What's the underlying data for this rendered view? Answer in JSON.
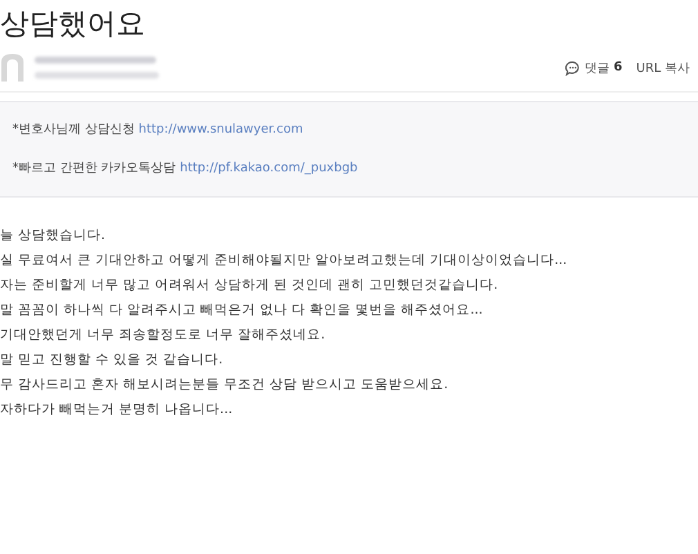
{
  "post": {
    "title": "상담했어요",
    "comments": {
      "label": "댓글",
      "count": "6"
    },
    "url_copy": "URL 복사"
  },
  "notice": [
    {
      "text": "*변호사님께 상담신청",
      "link": "http://www.snulawyer.com"
    },
    {
      "text": "*빠르고 간편한 카카오톡상담",
      "link": "http://pf.kakao.com/_puxbgb"
    }
  ],
  "body": [
    "늘 상담했습니다.",
    "실 무료여서 큰 기대안하고 어떻게 준비해야될지만 알아보려고했는데 기대이상이었습니다...",
    "자는 준비할게 너무 많고 어려워서 상담하게 된 것인데 괜히 고민했던것같습니다.",
    "말 꼼꼼이 하나씩 다 알려주시고 빼먹은거 없나 다 확인을 몇번을 해주셨어요...",
    "기대안했던게 너무 죄송할정도로 너무 잘해주셨네요.",
    "말 믿고 진행할 수 있을 것 같습니다.",
    "무 감사드리고 혼자 해보시려는분들 무조건 상담 받으시고 도움받으세요.",
    "자하다가 빼먹는거 분명히 나옵니다..."
  ]
}
